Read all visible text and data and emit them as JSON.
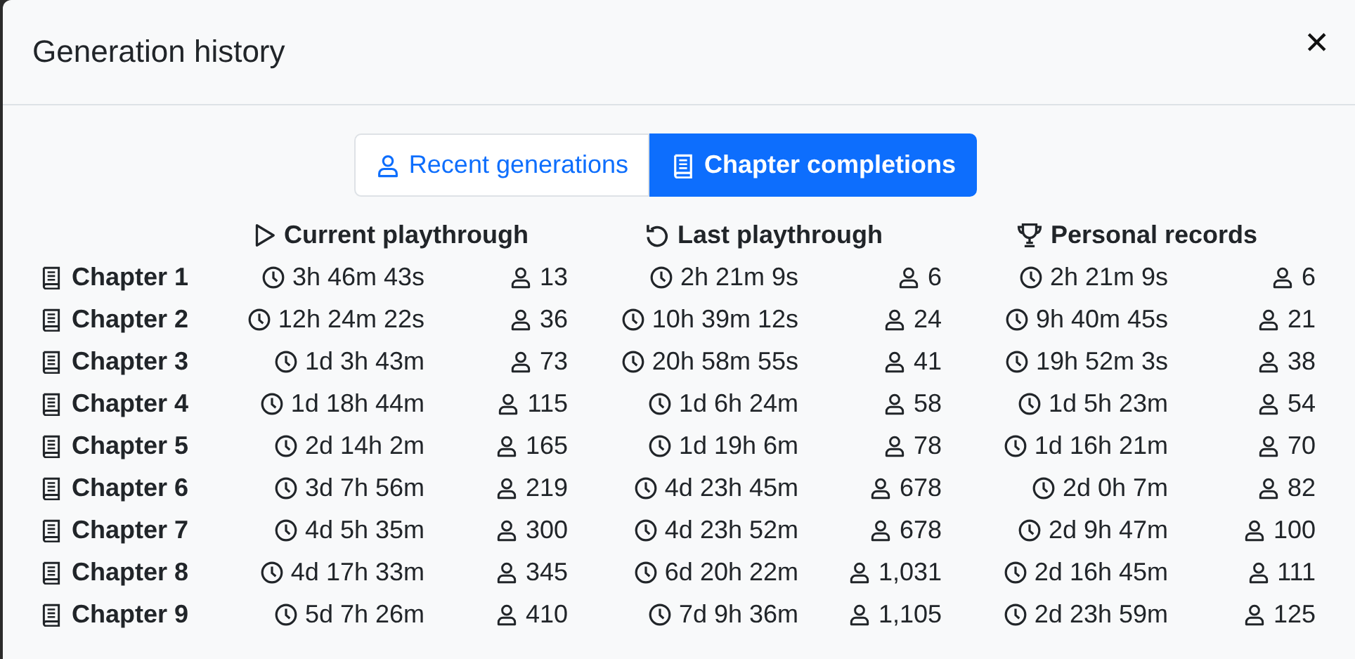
{
  "dialog": {
    "title": "Generation history",
    "close_label": "✕"
  },
  "tabs": [
    {
      "label": "Recent generations",
      "selected": false
    },
    {
      "label": "Chapter completions",
      "selected": true
    }
  ],
  "table": {
    "columns": [
      {
        "label": "Current playthrough"
      },
      {
        "label": "Last playthrough"
      },
      {
        "label": "Personal records"
      }
    ],
    "rows": [
      {
        "chapter": "Chapter 1",
        "cells": [
          {
            "time": "3h 46m 43s",
            "count": "13"
          },
          {
            "time": "2h 21m 9s",
            "count": "6"
          },
          {
            "time": "2h 21m 9s",
            "count": "6"
          }
        ]
      },
      {
        "chapter": "Chapter 2",
        "cells": [
          {
            "time": "12h 24m 22s",
            "count": "36"
          },
          {
            "time": "10h 39m 12s",
            "count": "24"
          },
          {
            "time": "9h 40m 45s",
            "count": "21"
          }
        ]
      },
      {
        "chapter": "Chapter 3",
        "cells": [
          {
            "time": "1d 3h 43m",
            "count": "73"
          },
          {
            "time": "20h 58m 55s",
            "count": "41"
          },
          {
            "time": "19h 52m 3s",
            "count": "38"
          }
        ]
      },
      {
        "chapter": "Chapter 4",
        "cells": [
          {
            "time": "1d 18h 44m",
            "count": "115"
          },
          {
            "time": "1d 6h 24m",
            "count": "58"
          },
          {
            "time": "1d 5h 23m",
            "count": "54"
          }
        ]
      },
      {
        "chapter": "Chapter 5",
        "cells": [
          {
            "time": "2d 14h 2m",
            "count": "165"
          },
          {
            "time": "1d 19h 6m",
            "count": "78"
          },
          {
            "time": "1d 16h 21m",
            "count": "70"
          }
        ]
      },
      {
        "chapter": "Chapter 6",
        "cells": [
          {
            "time": "3d 7h 56m",
            "count": "219"
          },
          {
            "time": "4d 23h 45m",
            "count": "678"
          },
          {
            "time": "2d 0h 7m",
            "count": "82"
          }
        ]
      },
      {
        "chapter": "Chapter 7",
        "cells": [
          {
            "time": "4d 5h 35m",
            "count": "300"
          },
          {
            "time": "4d 23h 52m",
            "count": "678"
          },
          {
            "time": "2d 9h 47m",
            "count": "100"
          }
        ]
      },
      {
        "chapter": "Chapter 8",
        "cells": [
          {
            "time": "4d 17h 33m",
            "count": "345"
          },
          {
            "time": "6d 20h 22m",
            "count": "1,031"
          },
          {
            "time": "2d 16h 45m",
            "count": "111"
          }
        ]
      },
      {
        "chapter": "Chapter 9",
        "cells": [
          {
            "time": "5d 7h 26m",
            "count": "410"
          },
          {
            "time": "7d 9h 36m",
            "count": "1,105"
          },
          {
            "time": "2d 23h 59m",
            "count": "125"
          }
        ]
      }
    ]
  }
}
